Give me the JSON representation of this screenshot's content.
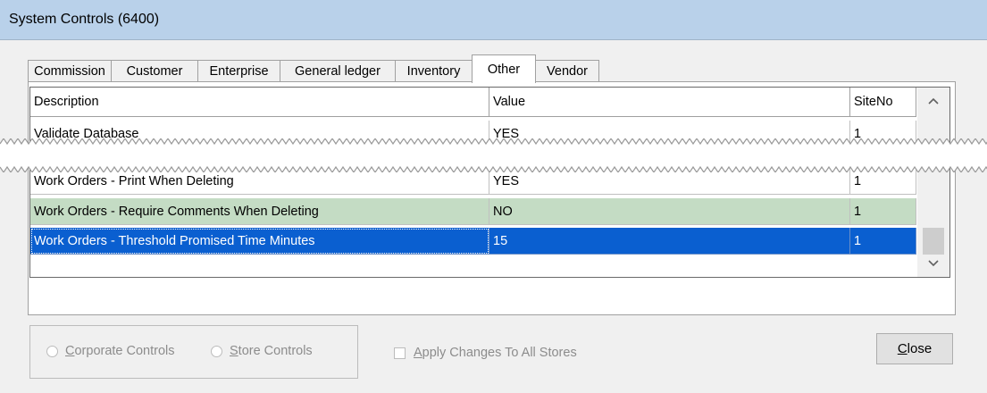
{
  "window": {
    "title": "System Controls (6400)"
  },
  "tabs": [
    {
      "label": "Commission"
    },
    {
      "label": "Customer"
    },
    {
      "label": "Enterprise"
    },
    {
      "label": "General ledger"
    },
    {
      "label": "Inventory"
    },
    {
      "label": "Other",
      "active": true
    },
    {
      "label": "Vendor"
    }
  ],
  "grid": {
    "columns": [
      "Description",
      "Value",
      "SiteNo"
    ],
    "rows": [
      {
        "description": "Validate Database",
        "value": "YES",
        "site": "1"
      },
      {
        "description": "Work Orders - Print When Deleting",
        "value": "YES",
        "site": "1"
      },
      {
        "description": "Work Orders - Require Comments When Deleting",
        "value": "NO",
        "site": "1",
        "state": "changed"
      },
      {
        "description": "Work Orders - Threshold Promised Time Minutes",
        "value": "15",
        "site": "1",
        "state": "selected"
      }
    ]
  },
  "options": {
    "corporate_pre": "",
    "corporate_key": "C",
    "corporate_post": "orporate Controls",
    "store_key": "S",
    "store_post": "tore Controls",
    "apply_key": "A",
    "apply_post": "pply Changes To All Stores"
  },
  "buttons": {
    "close_key": "C",
    "close_post": "lose"
  },
  "colors": {
    "changed_row": "#c4dcc4",
    "selected_row": "#0a5fd0",
    "titlebar": "#b9d1ea"
  },
  "icons": {
    "scroll_up": "chevron-up-icon",
    "scroll_down": "chevron-down-icon"
  }
}
